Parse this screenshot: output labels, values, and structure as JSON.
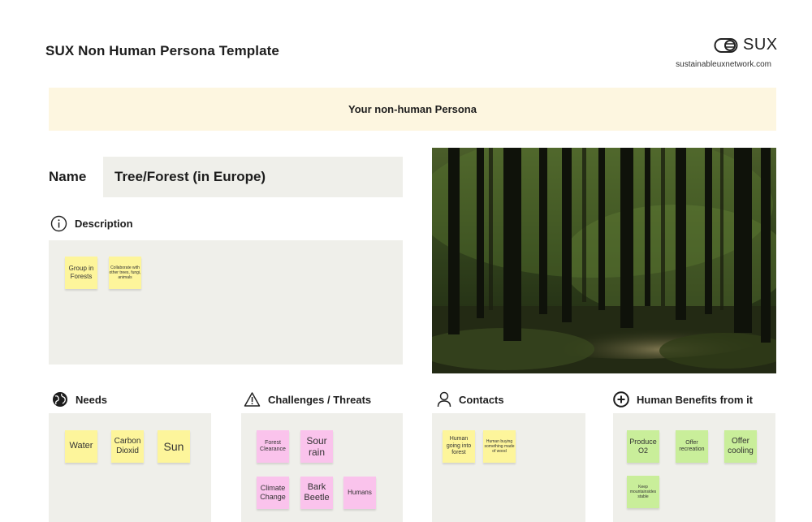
{
  "header": {
    "title": "SUX Non Human Persona Template",
    "logo_text": "SUX",
    "website": "sustainableuxnetwork.com"
  },
  "banner": {
    "label": "Your non-human Persona"
  },
  "name": {
    "label": "Name",
    "value": "Tree/Forest (in Europe)"
  },
  "description": {
    "heading": "Description",
    "icon": "info-icon",
    "notes": [
      "Group in Forests",
      "Collaborate with other trees, fungi, animals"
    ]
  },
  "needs": {
    "heading": "Needs",
    "icon": "globe-icon",
    "notes": [
      "Water",
      "Carbon Dioxid",
      "Sun"
    ]
  },
  "challenges": {
    "heading": "Challenges / Threats",
    "icon": "warning-icon",
    "notes": [
      "Forest Clearance",
      "Sour rain",
      "Climate Change",
      "Bark Beetle",
      "Humans"
    ]
  },
  "contacts": {
    "heading": "Contacts",
    "icon": "person-icon",
    "notes": [
      "Human going into forest",
      "Human buying something made of wood"
    ]
  },
  "benefits": {
    "heading": "Human Benefits from it",
    "icon": "plus-circle-icon",
    "notes": [
      "Produce O2",
      "Offer recreation",
      "Offer cooling",
      "Keep mountainsides stable"
    ]
  },
  "colors": {
    "banner": "#fdf6e0",
    "panel": "#efefea",
    "sticky_yellow": "#fdf59b",
    "sticky_pink": "#fac3ec",
    "sticky_green": "#c9ee9a"
  }
}
